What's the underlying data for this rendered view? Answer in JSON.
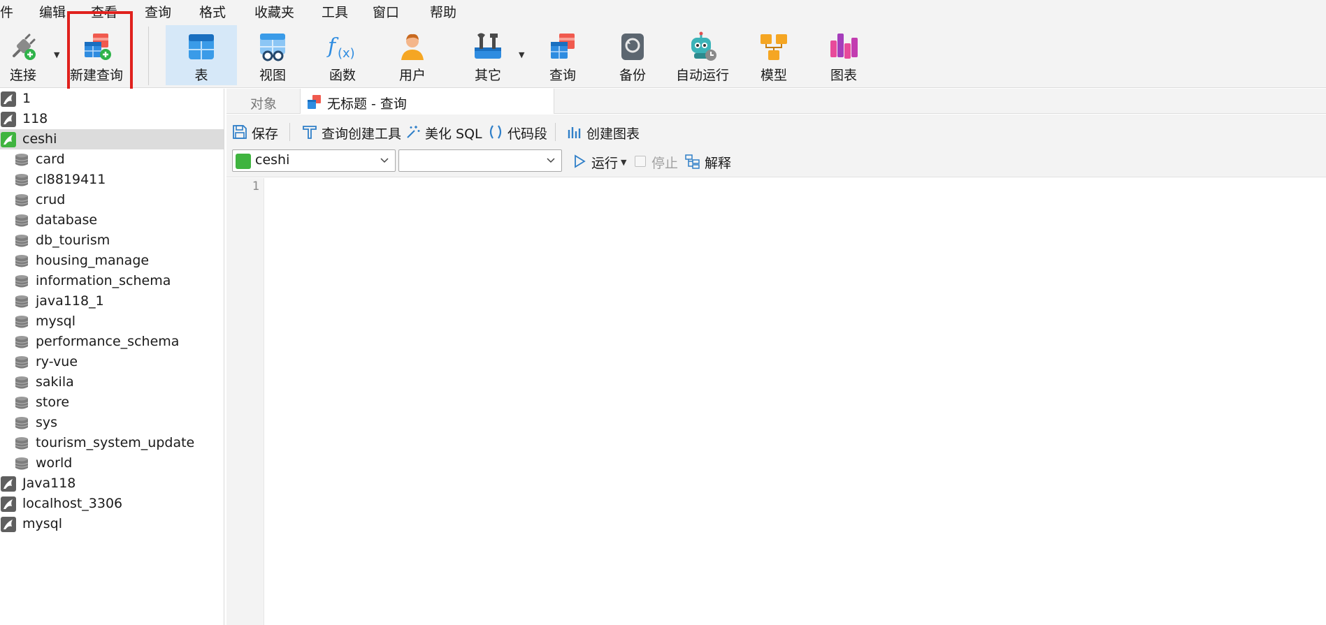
{
  "menu": {
    "items": [
      "件",
      "编辑",
      "查看",
      "查询",
      "格式",
      "收藏夹",
      "工具",
      "窗口",
      "帮助"
    ]
  },
  "toolbar": {
    "connect_label": "连接",
    "new_query_label": "新建查询",
    "table_label": "表",
    "view_label": "视图",
    "function_label": "函数",
    "user_label": "用户",
    "other_label": "其它",
    "query_label": "查询",
    "backup_label": "备份",
    "automation_label": "自动运行",
    "model_label": "模型",
    "chart_label": "图表",
    "active_tool": "表",
    "highlighted_tool": "新建查询",
    "highlight_color": "#e0211d"
  },
  "sidebar": {
    "selected": "ceshi",
    "connections": [
      {
        "label": "1"
      },
      {
        "label": "118"
      },
      {
        "label": "ceshi",
        "open": true
      },
      {
        "label": "Java118"
      },
      {
        "label": "localhost_3306"
      },
      {
        "label": "mysql"
      }
    ],
    "databases": [
      "card",
      "cl8819411",
      "crud",
      "database",
      "db_tourism",
      "housing_manage",
      "information_schema",
      "java118_1",
      "mysql",
      "performance_schema",
      "ry-vue",
      "sakila",
      "store",
      "sys",
      "tourism_system_update",
      "world"
    ]
  },
  "tabs": {
    "objects_label": "对象",
    "query_tab_label": "无标题 - 查询"
  },
  "query_toolbar": {
    "save_label": "保存",
    "query_builder_label": "查询创建工具",
    "beautify_label": "美化 SQL",
    "snippet_label": "代码段",
    "create_chart_label": "创建图表",
    "connection_value": "ceshi",
    "database_value": "",
    "run_label": "运行",
    "stop_label": "停止",
    "explain_label": "解释"
  },
  "editor": {
    "line_numbers": [
      "1"
    ]
  },
  "colors": {
    "accent_blue": "#1a7fd6",
    "conn_green": "#3fb43f",
    "active_tool_bg": "#d6e8f8"
  }
}
